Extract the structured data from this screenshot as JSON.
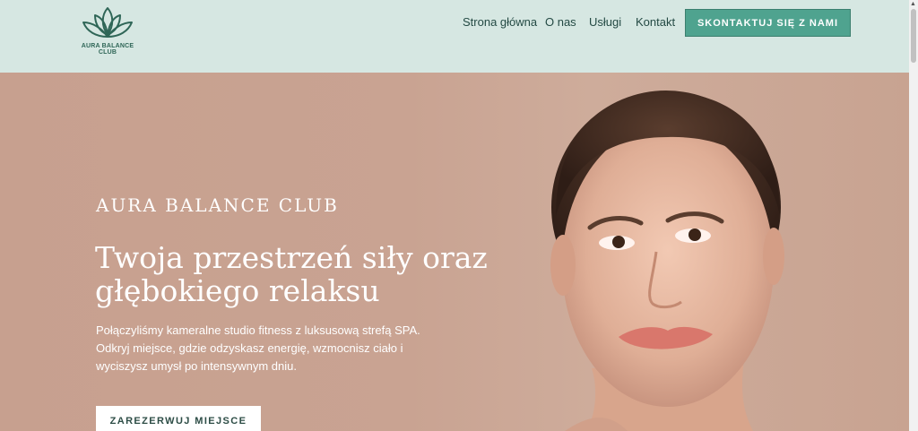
{
  "brand": {
    "name": "AURA BALANCE CLUB",
    "logo_icon": "lotus-icon",
    "color": "#2f6657"
  },
  "nav": {
    "items": [
      "Strona główna",
      "O nas",
      "Usługi",
      "Kontakt"
    ],
    "cta": "SKONTAKTUJ SIĘ Z NAMI"
  },
  "hero": {
    "eyebrow": "AURA BALANCE CLUB",
    "headline": "Twoja przestrzeń siły oraz głębokiego relaksu",
    "description": "Połączyliśmy kameralne studio fitness z luksusową strefą SPA. Odkryj miejsce, gdzie odzyskasz energię, wzmocnisz ciało i wyciszysz umysł po intensywnym dniu.",
    "button": "ZAREZERWUJ MIEJSCE"
  },
  "colors": {
    "header_bg": "#d6e7e2",
    "accent": "#4fa38f",
    "hero_bg": "#c9a291"
  }
}
